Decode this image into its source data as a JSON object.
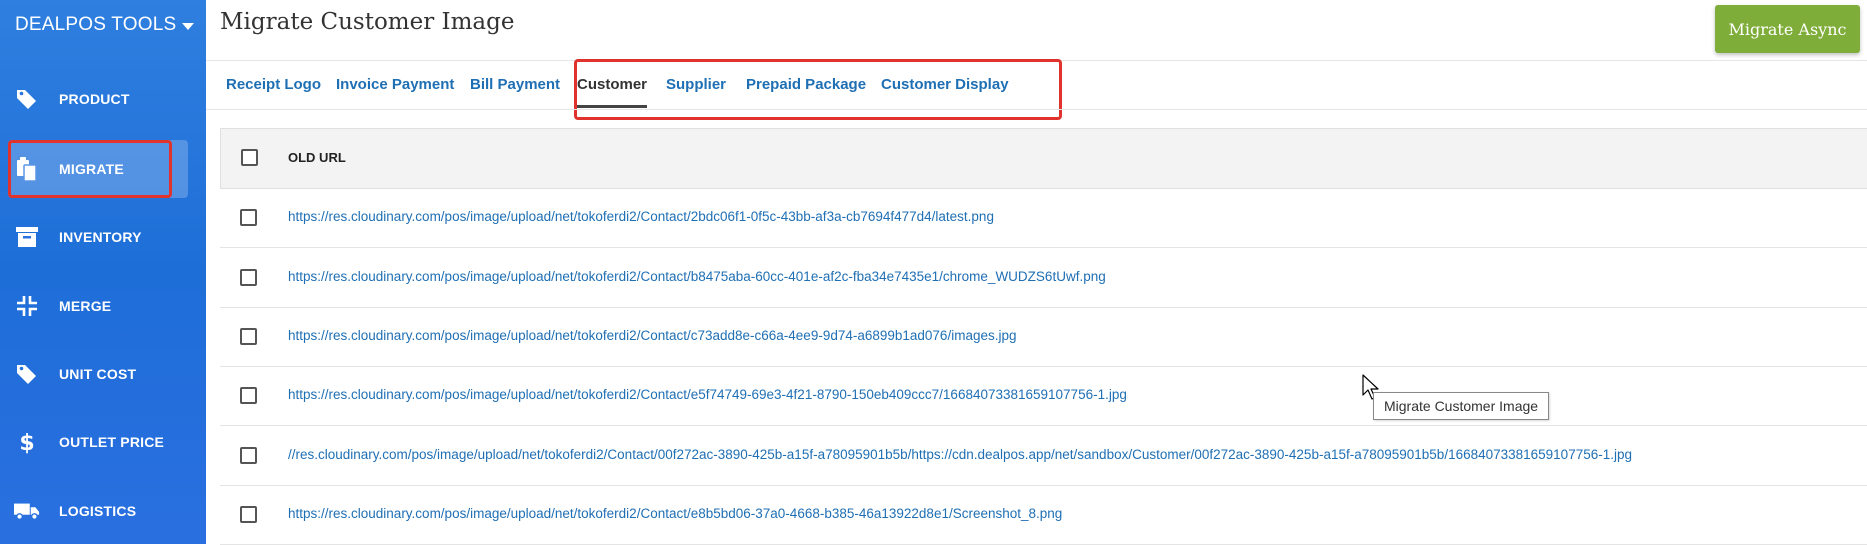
{
  "sidebar": {
    "brand": "DEALPOS TOOLS",
    "items": [
      {
        "label": "PRODUCT",
        "icon": "tag-icon"
      },
      {
        "label": "MIGRATE",
        "icon": "copy-icon"
      },
      {
        "label": "INVENTORY",
        "icon": "archive-icon"
      },
      {
        "label": "MERGE",
        "icon": "merge-icon"
      },
      {
        "label": "UNIT COST",
        "icon": "tag-icon"
      },
      {
        "label": "OUTLET PRICE",
        "icon": "dollar-icon"
      },
      {
        "label": "LOGISTICS",
        "icon": "truck-icon"
      }
    ]
  },
  "header": {
    "title": "Migrate Customer Image",
    "async_button": "Migrate Async"
  },
  "tabs": [
    {
      "label": "Receipt Logo"
    },
    {
      "label": "Invoice Payment"
    },
    {
      "label": "Bill Payment"
    },
    {
      "label": "Customer"
    },
    {
      "label": "Supplier"
    },
    {
      "label": "Prepaid Package"
    },
    {
      "label": "Customer Display"
    }
  ],
  "active_tab": "Customer",
  "table": {
    "header": "OLD URL",
    "rows": [
      "https://res.cloudinary.com/pos/image/upload/net/tokoferdi2/Contact/2bdc06f1-0f5c-43bb-af3a-cb7694f477d4/latest.png",
      "https://res.cloudinary.com/pos/image/upload/net/tokoferdi2/Contact/b8475aba-60cc-401e-af2c-fba34e7435e1/chrome_WUDZS6tUwf.png",
      "https://res.cloudinary.com/pos/image/upload/net/tokoferdi2/Contact/c73add8e-c66a-4ee9-9d74-a6899b1ad076/images.jpg",
      "https://res.cloudinary.com/pos/image/upload/net/tokoferdi2/Contact/e5f74749-69e3-4f21-8790-150eb409ccc7/16684073381659107756-1.jpg",
      "//res.cloudinary.com/pos/image/upload/net/tokoferdi2/Contact/00f272ac-3890-425b-a15f-a78095901b5b/https://cdn.dealpos.app/net/sandbox/Customer/00f272ac-3890-425b-a15f-a78095901b5b/16684073381659107756-1.jpg",
      "https://res.cloudinary.com/pos/image/upload/net/tokoferdi2/Contact/e8b5bd06-37a0-4668-b385-46a13922d8e1/Screenshot_8.png"
    ]
  },
  "tooltip": "Migrate Customer Image",
  "colors": {
    "sidebar": "#2a73de",
    "accent_button": "#7fad3a",
    "link": "#1f6fb4",
    "highlight": "#e0332e"
  }
}
